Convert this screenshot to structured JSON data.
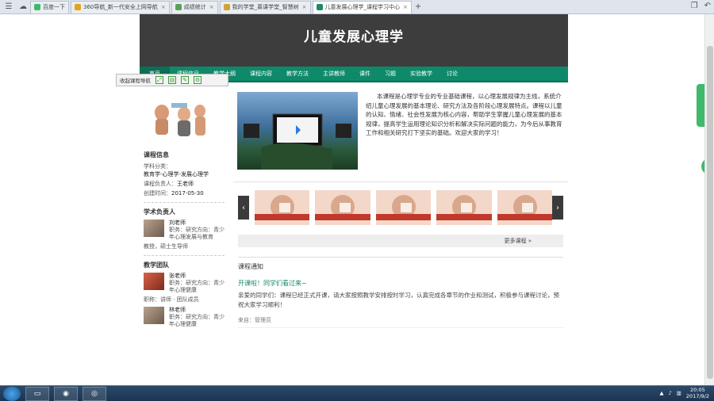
{
  "browser": {
    "tabs": [
      {
        "label": "百度一下",
        "fav": "#3fba6a",
        "active": false
      },
      {
        "label": "360导航_新一代安全上网导航",
        "fav": "#e6a21a",
        "active": false
      },
      {
        "label": "成绩统计",
        "fav": "#5aa05a",
        "active": false
      },
      {
        "label": "我的学堂_慕课学堂_智慧树",
        "fav": "#d2a13a",
        "active": false
      },
      {
        "label": "儿童发展心理学_课程学习中心",
        "fav": "#1a8a6a",
        "active": true
      }
    ],
    "new_tab_symbol": "+",
    "close_symbol": "×"
  },
  "site": {
    "title": "儿童发展心理学",
    "nav": [
      "首页",
      "课程信息",
      "教学大纲",
      "课程内容",
      "教学方法",
      "主讲教师",
      "课件",
      "习题",
      "实验教学",
      "讨论"
    ]
  },
  "toolbar": {
    "label": "收起课程导航"
  },
  "left": {
    "section_course": "课程信息",
    "course_info": [
      {
        "k": "学科分类：",
        "v": "教育学-心理学-发展心理学"
      },
      {
        "k": "课程负责人：",
        "v": "王老师"
      },
      {
        "k": "创建时间：",
        "v": "2017-05-30"
      }
    ],
    "section_leader": "学术负责人",
    "leader": {
      "name": "刘老师",
      "desc": "职务：研究方向：青少年心理发展与教育"
    },
    "leader_note": "教授，硕士生导师",
    "section_team": "教学团队",
    "team": [
      {
        "name": "张老师",
        "desc": "职务：研究方向：青少年心理健康"
      },
      {
        "name": "林老师",
        "desc": "职务：研究方向：青少年心理健康"
      }
    ],
    "team_note": "职称：讲师 · 团队成员"
  },
  "intro": {
    "text": "本课程是心理学专业的专业基础课程，以心理发展规律为主线，系统介绍儿童心理发展的基本理论、研究方法及各阶段心理发展特点。课程以儿童的认知、情绪、社会性发展为核心内容，帮助学生掌握儿童心理发展的基本规律，提高学生运用理论知识分析和解决实际问题的能力，为今后从事教育工作和相关研究打下坚实的基础。欢迎大家的学习！"
  },
  "gray_bar": {
    "text": "更多课程 »"
  },
  "notice": {
    "heading": "课程通知",
    "title": "开课啦！同学们看过来~",
    "body": "亲爱的同学们：课程已经正式开课，请大家按照教学安排按时学习，认真完成各章节的作业和测试，积极参与课程讨论，预祝大家学习顺利！",
    "from": "来自：管理员"
  },
  "taskbar": {
    "time": "20:05",
    "date": "2017/9/2"
  }
}
